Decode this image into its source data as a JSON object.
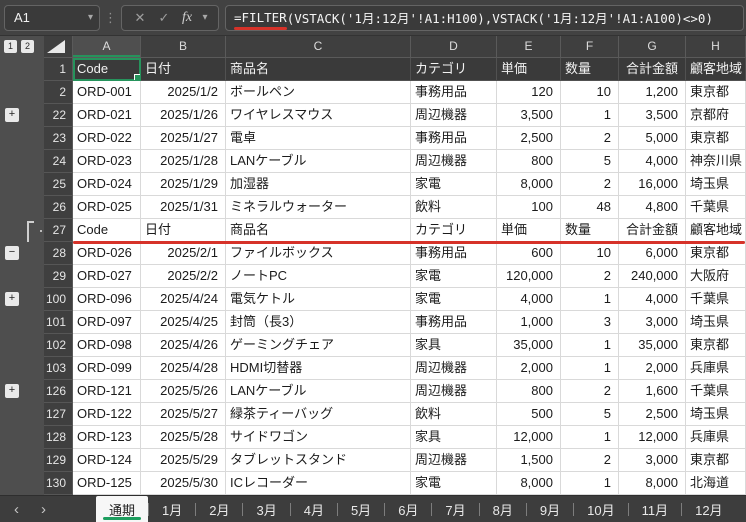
{
  "formula_bar": {
    "name_box": "A1",
    "formula_function": "=FILTER",
    "formula_args": "(VSTACK('1月:12月'!A1:H100),VSTACK('1月:12月'!A1:A100)<>0)"
  },
  "colors": {
    "selection_green": "#26935c",
    "tab_green": "#1d9e5f",
    "annotation_red": "#d63229"
  },
  "grid": {
    "outline_level_buttons": [
      "1",
      "2"
    ],
    "column_letters": [
      "A",
      "B",
      "C",
      "D",
      "E",
      "F",
      "G",
      "H"
    ],
    "selected_column": "A",
    "selected_cell": "A1",
    "rows": [
      {
        "n": "1",
        "t": "h",
        "o": "",
        "c": [
          "Code",
          "日付",
          "商品名",
          "カテゴリ",
          "単価",
          "数量",
          "合計金額",
          "顧客地域"
        ]
      },
      {
        "n": "2",
        "t": "d",
        "o": "",
        "c": [
          "ORD-001",
          "2025/1/2",
          "ボールペン",
          "事務用品",
          "120",
          "10",
          "1,200",
          "東京都"
        ]
      },
      {
        "n": "22",
        "t": "d",
        "o": "plus",
        "c": [
          "ORD-021",
          "2025/1/26",
          "ワイヤレスマウス",
          "周辺機器",
          "3,500",
          "1",
          "3,500",
          "京都府"
        ]
      },
      {
        "n": "23",
        "t": "d",
        "o": "",
        "c": [
          "ORD-022",
          "2025/1/27",
          "電卓",
          "事務用品",
          "2,500",
          "2",
          "5,000",
          "東京都"
        ]
      },
      {
        "n": "24",
        "t": "d",
        "o": "",
        "c": [
          "ORD-023",
          "2025/1/28",
          "LANケーブル",
          "周辺機器",
          "800",
          "5",
          "4,000",
          "神奈川県"
        ]
      },
      {
        "n": "25",
        "t": "d",
        "o": "",
        "c": [
          "ORD-024",
          "2025/1/29",
          "加湿器",
          "家電",
          "8,000",
          "2",
          "16,000",
          "埼玉県"
        ]
      },
      {
        "n": "26",
        "t": "d",
        "o": "",
        "c": [
          "ORD-025",
          "2025/1/31",
          "ミネラルウォーター",
          "飲料",
          "100",
          "48",
          "4,800",
          "千葉県"
        ]
      },
      {
        "n": "27",
        "t": "r",
        "o": "bracket",
        "c": [
          "Code",
          "日付",
          "商品名",
          "カテゴリ",
          "単価",
          "数量",
          "合計金額",
          "顧客地域"
        ]
      },
      {
        "n": "28",
        "t": "d",
        "o": "minus",
        "c": [
          "ORD-026",
          "2025/2/1",
          "ファイルボックス",
          "事務用品",
          "600",
          "10",
          "6,000",
          "東京都"
        ]
      },
      {
        "n": "29",
        "t": "d",
        "o": "",
        "c": [
          "ORD-027",
          "2025/2/2",
          "ノートPC",
          "家電",
          "120,000",
          "2",
          "240,000",
          "大阪府"
        ]
      },
      {
        "n": "100",
        "t": "d",
        "o": "plus",
        "c": [
          "ORD-096",
          "2025/4/24",
          "電気ケトル",
          "家電",
          "4,000",
          "1",
          "4,000",
          "千葉県"
        ]
      },
      {
        "n": "101",
        "t": "d",
        "o": "",
        "c": [
          "ORD-097",
          "2025/4/25",
          "封筒（長3）",
          "事務用品",
          "1,000",
          "3",
          "3,000",
          "埼玉県"
        ]
      },
      {
        "n": "102",
        "t": "d",
        "o": "",
        "c": [
          "ORD-098",
          "2025/4/26",
          "ゲーミングチェア",
          "家具",
          "35,000",
          "1",
          "35,000",
          "東京都"
        ]
      },
      {
        "n": "103",
        "t": "d",
        "o": "",
        "c": [
          "ORD-099",
          "2025/4/28",
          "HDMI切替器",
          "周辺機器",
          "2,000",
          "1",
          "2,000",
          "兵庫県"
        ]
      },
      {
        "n": "126",
        "t": "d",
        "o": "plus",
        "c": [
          "ORD-121",
          "2025/5/26",
          "LANケーブル",
          "周辺機器",
          "800",
          "2",
          "1,600",
          "千葉県"
        ]
      },
      {
        "n": "127",
        "t": "d",
        "o": "",
        "c": [
          "ORD-122",
          "2025/5/27",
          "緑茶ティーバッグ",
          "飲料",
          "500",
          "5",
          "2,500",
          "埼玉県"
        ]
      },
      {
        "n": "128",
        "t": "d",
        "o": "",
        "c": [
          "ORD-123",
          "2025/5/28",
          "サイドワゴン",
          "家具",
          "12,000",
          "1",
          "12,000",
          "兵庫県"
        ]
      },
      {
        "n": "129",
        "t": "d",
        "o": "",
        "c": [
          "ORD-124",
          "2025/5/29",
          "タブレットスタンド",
          "周辺機器",
          "1,500",
          "2",
          "3,000",
          "東京都"
        ]
      },
      {
        "n": "130",
        "t": "d",
        "o": "",
        "c": [
          "ORD-125",
          "2025/5/30",
          "ICレコーダー",
          "家電",
          "8,000",
          "1",
          "8,000",
          "北海道"
        ]
      }
    ]
  },
  "sheet_tabs": {
    "active": "通期",
    "tabs": [
      "通期",
      "1月",
      "2月",
      "3月",
      "4月",
      "5月",
      "6月",
      "7月",
      "8月",
      "9月",
      "10月",
      "11月",
      "12月"
    ]
  }
}
